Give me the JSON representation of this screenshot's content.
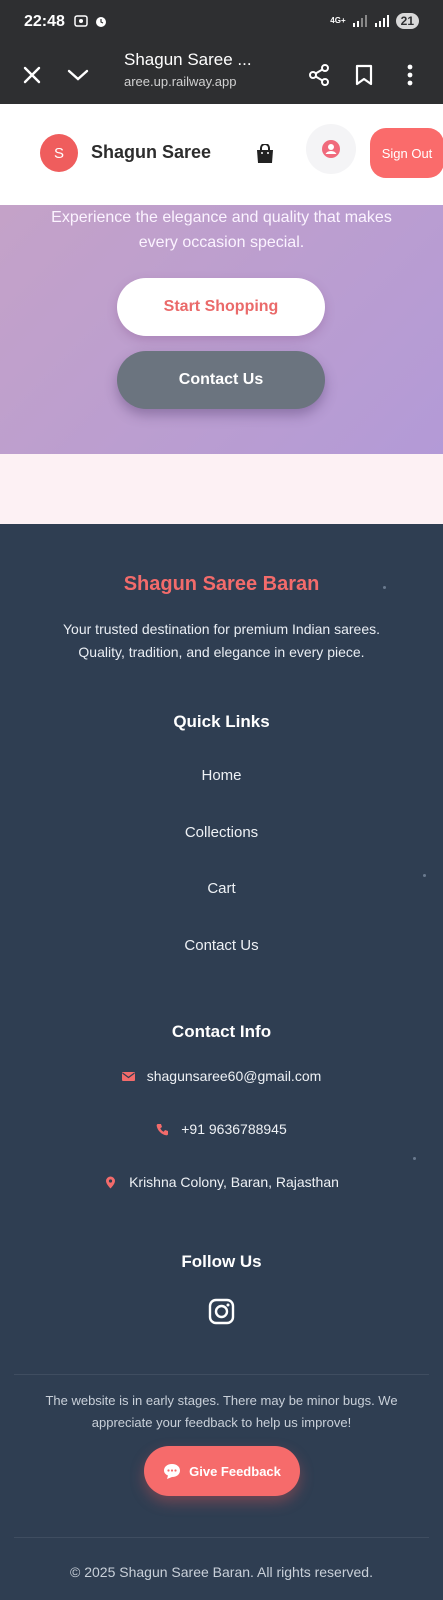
{
  "status_bar": {
    "time": "22:48",
    "network": "4G+",
    "battery": "21"
  },
  "browser": {
    "page_title": "Shagun Saree ...",
    "url": "aree.up.railway.app",
    "icons": [
      "close-icon",
      "chevron-down-icon",
      "share-icon",
      "bookmark-icon",
      "more-vert-icon"
    ]
  },
  "header": {
    "logo_letter": "S",
    "brand": "Shagun Saree",
    "sign_out": "Sign Out",
    "accent": "#fa6b6b"
  },
  "hero": {
    "tagline": "Experience the elegance and quality that makes every occasion special.",
    "start_shopping": "Start Shopping",
    "contact_us": "Contact Us"
  },
  "footer": {
    "brand": "Shagun Saree Baran",
    "description": "Your trusted destination for premium Indian sarees. Quality, tradition, and elegance in every piece.",
    "quick_links_heading": "Quick Links",
    "quick_links": [
      "Home",
      "Collections",
      "Cart",
      "Contact Us"
    ],
    "contact_heading": "Contact Info",
    "email": "shagunsaree60@gmail.com",
    "phone": "+91 9636788945",
    "address": "Krishna Colony, Baran, Rajasthan",
    "follow_heading": "Follow Us",
    "notice": "The website is in early stages. There may be minor bugs. We appreciate your feedback to help us improve!",
    "feedback_button": "Give Feedback",
    "copyright": "© 2025 Shagun Saree Baran. All rights reserved."
  }
}
